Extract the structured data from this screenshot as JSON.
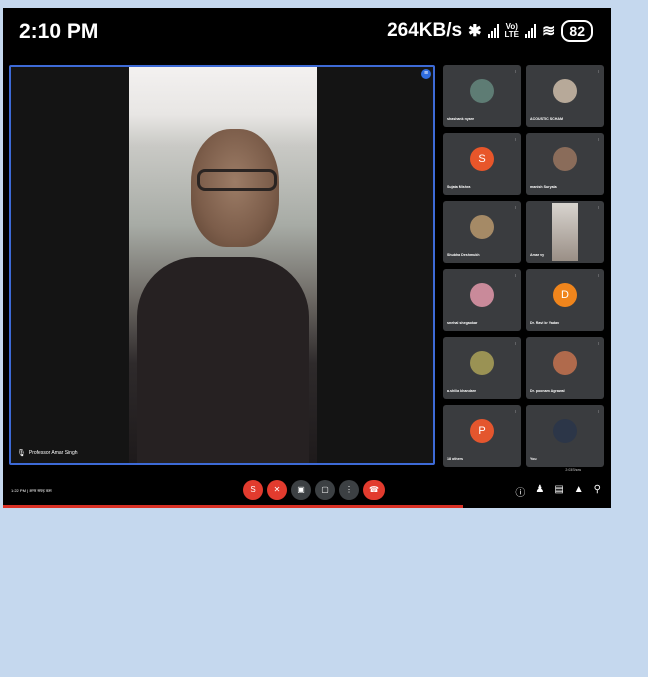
{
  "status_bar": {
    "time": "2:10 PM",
    "speed": "264KB/s",
    "lte_label": "Vo)\nLTE",
    "battery": "82"
  },
  "main_speaker": {
    "name": "Professor Amar Singh"
  },
  "participants": [
    {
      "name": "shashank nyare",
      "initial": "",
      "avatar_color": "#5e7c74",
      "type": "photo"
    },
    {
      "name": "ACOUSTIC SCHAM",
      "initial": "",
      "avatar_color": "#b7a999",
      "type": "photo"
    },
    {
      "name": "Sujata Mishra",
      "initial": "S",
      "avatar_color": "#e8562a",
      "type": "letter"
    },
    {
      "name": "manish Suryala",
      "initial": "",
      "avatar_color": "#8a6c5a",
      "type": "photo"
    },
    {
      "name": "Shubha Deshmukh",
      "initial": "",
      "avatar_color": "#a58a66",
      "type": "photo"
    },
    {
      "name": "Amar vy",
      "initial": "",
      "avatar_color": "#c9c2ba",
      "type": "video"
    },
    {
      "name": "snehal shegaokar",
      "initial": "",
      "avatar_color": "#c98a9a",
      "type": "photo"
    },
    {
      "name": "Dr. Ravi kr Yadav",
      "initial": "D",
      "avatar_color": "#f0851c",
      "type": "letter"
    },
    {
      "name": "a.shilia khandare",
      "initial": "",
      "avatar_color": "#9a9254",
      "type": "photo"
    },
    {
      "name": "Dr. poonam Agrawal",
      "initial": "",
      "avatar_color": "#b06a4c",
      "type": "photo"
    },
    {
      "name": "18 others",
      "initial": "P",
      "avatar_color": "#e4562e",
      "type": "others"
    },
    {
      "name": "You",
      "initial": "",
      "avatar_color": "#2c3648",
      "type": "photo"
    }
  ],
  "toolbar": {
    "left_text": "1:22 PM  |  अमर सफ्ह कस",
    "tooltip": "2:03Show",
    "buttons": [
      "S",
      "mic",
      "cam",
      "cc",
      "more",
      "end"
    ]
  },
  "colors": {
    "page_bg": "#c5d8ee",
    "active_border": "#3d6ad6",
    "end_call": "#e23b2e",
    "tile_bg": "#3a3c3f"
  }
}
